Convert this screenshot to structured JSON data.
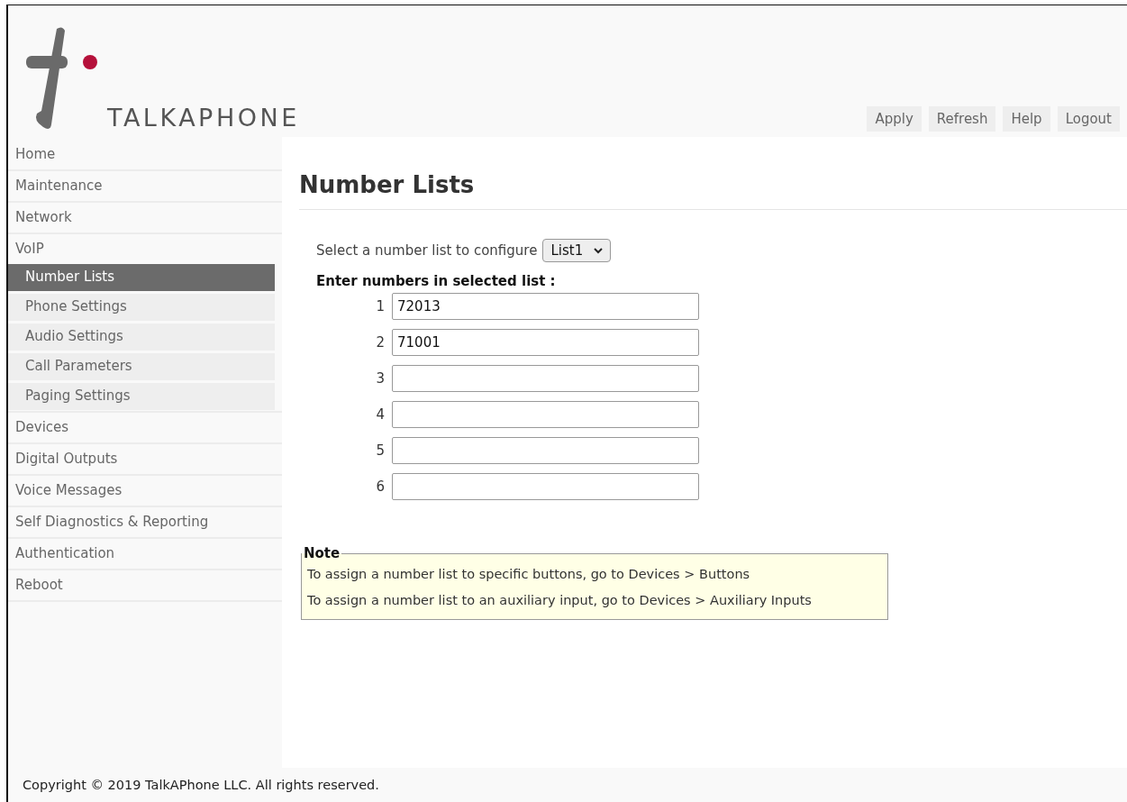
{
  "logo": {
    "text": "TALKAPHONE"
  },
  "header_buttons": [
    "Apply",
    "Refresh",
    "Help",
    "Logout"
  ],
  "sidebar": {
    "items": [
      {
        "label": "Home",
        "selected": false
      },
      {
        "label": "Maintenance",
        "selected": false
      },
      {
        "label": "Network",
        "selected": false
      },
      {
        "label": "VoIP",
        "selected": false,
        "children": [
          {
            "label": "Number Lists",
            "selected": true
          },
          {
            "label": "Phone Settings",
            "selected": false
          },
          {
            "label": "Audio Settings",
            "selected": false
          },
          {
            "label": "Call Parameters",
            "selected": false
          },
          {
            "label": "Paging Settings",
            "selected": false
          }
        ]
      },
      {
        "label": "Devices",
        "selected": false
      },
      {
        "label": "Digital Outputs",
        "selected": false
      },
      {
        "label": "Voice Messages",
        "selected": false
      },
      {
        "label": "Self Diagnostics & Reporting",
        "selected": false
      },
      {
        "label": "Authentication",
        "selected": false
      },
      {
        "label": "Reboot",
        "selected": false
      }
    ]
  },
  "page_title": "Number Lists",
  "list_select": {
    "label": "Select a number list to configure",
    "value": "List1"
  },
  "numbers_heading": "Enter numbers in selected list :",
  "numbers": [
    {
      "index": "1",
      "value": "72013"
    },
    {
      "index": "2",
      "value": "71001"
    },
    {
      "index": "3"
    },
    {
      "index": "4"
    },
    {
      "index": "5"
    },
    {
      "index": "6"
    }
  ],
  "note": {
    "title": "Note",
    "lines": [
      "To assign a number list to specific buttons, go to Devices > Buttons",
      "To assign a number list to an auxiliary input, go to Devices > Auxiliary Inputs"
    ]
  },
  "footer": "Copyright © 2019 TalkAPhone LLC. All rights reserved."
}
